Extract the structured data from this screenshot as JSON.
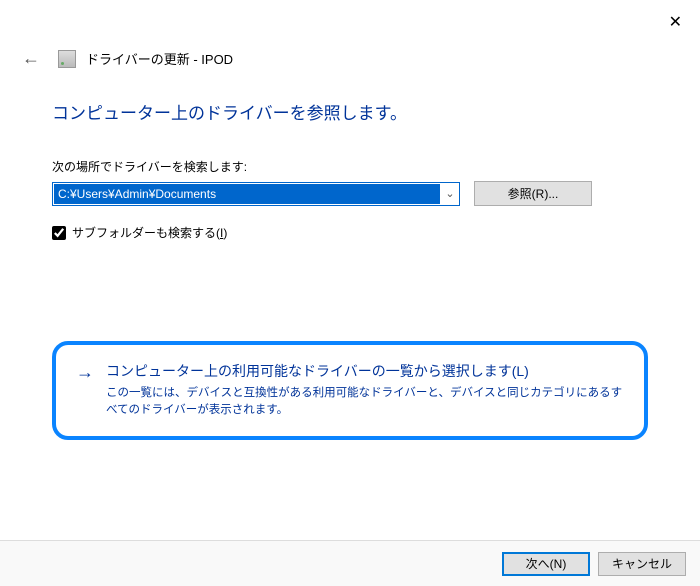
{
  "window": {
    "title": "ドライバーの更新 - IPOD"
  },
  "heading": "コンピューター上のドライバーを参照します。",
  "search": {
    "label": "次の場所でドライバーを検索します:",
    "path": "C:¥Users¥Admin¥Documents",
    "browse": "参照(R)..."
  },
  "subfolder": {
    "checked": true,
    "label_prefix": "サブフォルダーも検索する(",
    "label_key": "I",
    "label_suffix": ")"
  },
  "option": {
    "title": "コンピューター上の利用可能なドライバーの一覧から選択します(L)",
    "description": "この一覧には、デバイスと互換性がある利用可能なドライバーと、デバイスと同じカテゴリにあるすべてのドライバーが表示されます。"
  },
  "footer": {
    "next": "次へ(N)",
    "cancel": "キャンセル"
  }
}
